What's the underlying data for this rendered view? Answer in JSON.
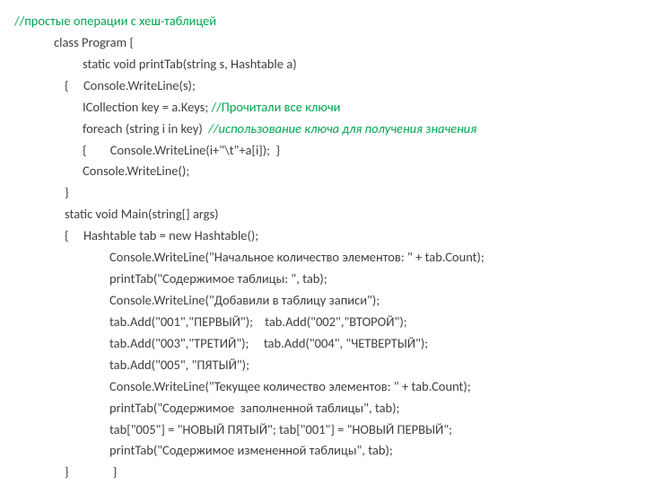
{
  "lines": {
    "l0": {
      "pre": "",
      "code": "",
      "comment": "//простые операции с хеш-таблицей"
    },
    "l1": "class Program {",
    "l2": "static void printTab(string s, Hashtable a)",
    "l3": "{     Console.WriteLine(s);",
    "l4a": "ICollection key = a.Keys; ",
    "l4c": "//Прочитали все ключи",
    "l5a": "foreach (string i in key)  ",
    "l5c": "//использование ключа для получения значения",
    "l6": "{        Console.WriteLine(i+\"\\t\"+a[i]);  }",
    "l7": "Console.WriteLine();",
    "l8": "}",
    "l9": "static void Main(string[] args)",
    "l10": "{     Hashtable tab = new Hashtable();",
    "l11": "Console.WriteLine(\"Начальное количество элементов: \" + tab.Count);",
    "l12": "printTab(\"Содержимое таблицы: \", tab);",
    "l13": "Console.WriteLine(\"Добавили в таблицу записи\");",
    "l14": "tab.Add(\"001\",\"ПЕРВЫЙ\");    tab.Add(\"002\",\"ВТОРОЙ\");",
    "l15": "tab.Add(\"003\",\"ТРЕТИЙ\");     tab.Add(\"004\", \"ЧЕТВЕРТЫЙ\");",
    "l16": "tab.Add(\"005\", \"ПЯТЫЙ\");",
    "l17": "Console.WriteLine(\"Текущее количество элементов: \" + tab.Count);",
    "l18": "printTab(\"Содержимое  заполненной таблицы\", tab);",
    "l19": "tab[\"005\"] = \"НОВЫЙ ПЯТЫЙ\"; tab[\"001\"] = \"НОВЫЙ ПЕРВЫЙ\";",
    "l20": "printTab(\"Содержимое измененной таблицы\", tab);",
    "l21": "}               }"
  }
}
